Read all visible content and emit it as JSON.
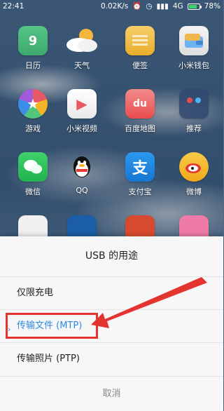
{
  "status_bar": {
    "time": "22:41",
    "network_speed": "0.02K/s",
    "network_type": "4G",
    "battery_percent": "78%",
    "icons": [
      "alarm-icon",
      "clock-icon",
      "signal-icon",
      "battery-icon"
    ]
  },
  "apps": [
    {
      "label": "日历",
      "icon": "calendar-icon",
      "text": "9",
      "color": "#4fbf7f"
    },
    {
      "label": "天气",
      "icon": "weather-icon",
      "text": "",
      "color": "#f5b63d"
    },
    {
      "label": "便签",
      "icon": "notes-icon",
      "text": "",
      "color": "#f2c24f"
    },
    {
      "label": "小米钱包",
      "icon": "wallet-icon",
      "text": "",
      "color": "#f1f1f1"
    },
    {
      "label": "游戏",
      "icon": "game-icon",
      "text": "★",
      "color": "#e85a63"
    },
    {
      "label": "小米视频",
      "icon": "video-icon",
      "text": "▶",
      "color": "#f2f2f2"
    },
    {
      "label": "百度地图",
      "icon": "baidu-map-icon",
      "text": "du",
      "color": "#e94d4d"
    },
    {
      "label": "推荐",
      "icon": "recommend-icon",
      "text": "",
      "color": "#3f567a"
    },
    {
      "label": "微信",
      "icon": "wechat-icon",
      "text": "",
      "color": "#2ecc5c"
    },
    {
      "label": "QQ",
      "icon": "qq-icon",
      "text": "",
      "color": "#1e1e1e"
    },
    {
      "label": "支付宝",
      "icon": "alipay-icon",
      "text": "支",
      "color": "#1e88e5"
    },
    {
      "label": "微博",
      "icon": "weibo-icon",
      "text": "",
      "color": "#f3b428"
    }
  ],
  "dialog": {
    "title": "USB 的用途",
    "options": [
      {
        "label": "仅限充电",
        "selected": false
      },
      {
        "label": "传输文件 (MTP)",
        "selected": true
      },
      {
        "label": "传输照片 (PTP)",
        "selected": false
      }
    ],
    "cancel": "取消"
  },
  "colors": {
    "accent": "#2d8ae6",
    "annotation": "#e3342f"
  }
}
